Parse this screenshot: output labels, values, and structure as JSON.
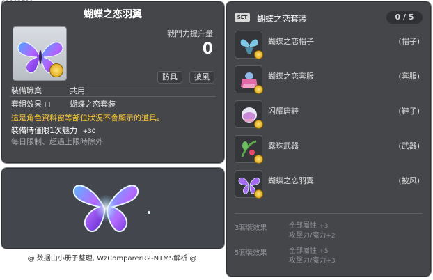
{
  "item_id": "01102729",
  "item": {
    "name": "蝴蝶之恋羽翼",
    "power_label": "戰鬥力提升量",
    "power_value": "0",
    "tags": [
      "防具",
      "披風"
    ],
    "job_label": "裝備職業",
    "job_value": "共用",
    "set_label": "套組效果",
    "set_value": "蝴蝶之恋套装",
    "notice": "這是角色資料窗等部位狀況不會顯示的道具。",
    "bonus_label": "裝備時僅限1次魅力",
    "bonus_value": "+30",
    "restriction": "每日限制、超過上限時除外",
    "icon": "butterfly-wing-icon"
  },
  "footer": "@ 数据由小册子整理, WzComparerR2-NTMS解析 @",
  "set": {
    "badge": "SET",
    "title": "蝴蝶之恋套装",
    "count": "0 / 5",
    "items": [
      {
        "name": "蝴蝶之恋帽子",
        "slot": "(帽子)",
        "icon": "butterfly-hat-icon"
      },
      {
        "name": "蝴蝶之恋套服",
        "slot": "(套服)",
        "icon": "butterfly-outfit-icon"
      },
      {
        "name": "闪耀唐鞋",
        "slot": "(鞋子)",
        "icon": "shining-shoes-icon"
      },
      {
        "name": "露珠武器",
        "slot": "(武器)",
        "icon": "dewdrop-weapon-icon"
      },
      {
        "name": "蝴蝶之恋羽翼",
        "slot": "(披风)",
        "icon": "butterfly-wing-icon"
      }
    ],
    "effects": [
      {
        "label": "3套裝效果",
        "line1": "全部屬性",
        "line1_value": "+3",
        "line2": "攻擊力/魔力",
        "line2_value": "+2"
      },
      {
        "label": "5套裝效果",
        "line1": "全部屬性",
        "line1_value": "+5",
        "line2": "攻擊力/魔力",
        "line2_value": "+3"
      }
    ]
  },
  "colors": {
    "panel": "#44464a",
    "notice": "#ffcc33",
    "muted": "#a6a8ac",
    "coin": "#f2c227"
  }
}
